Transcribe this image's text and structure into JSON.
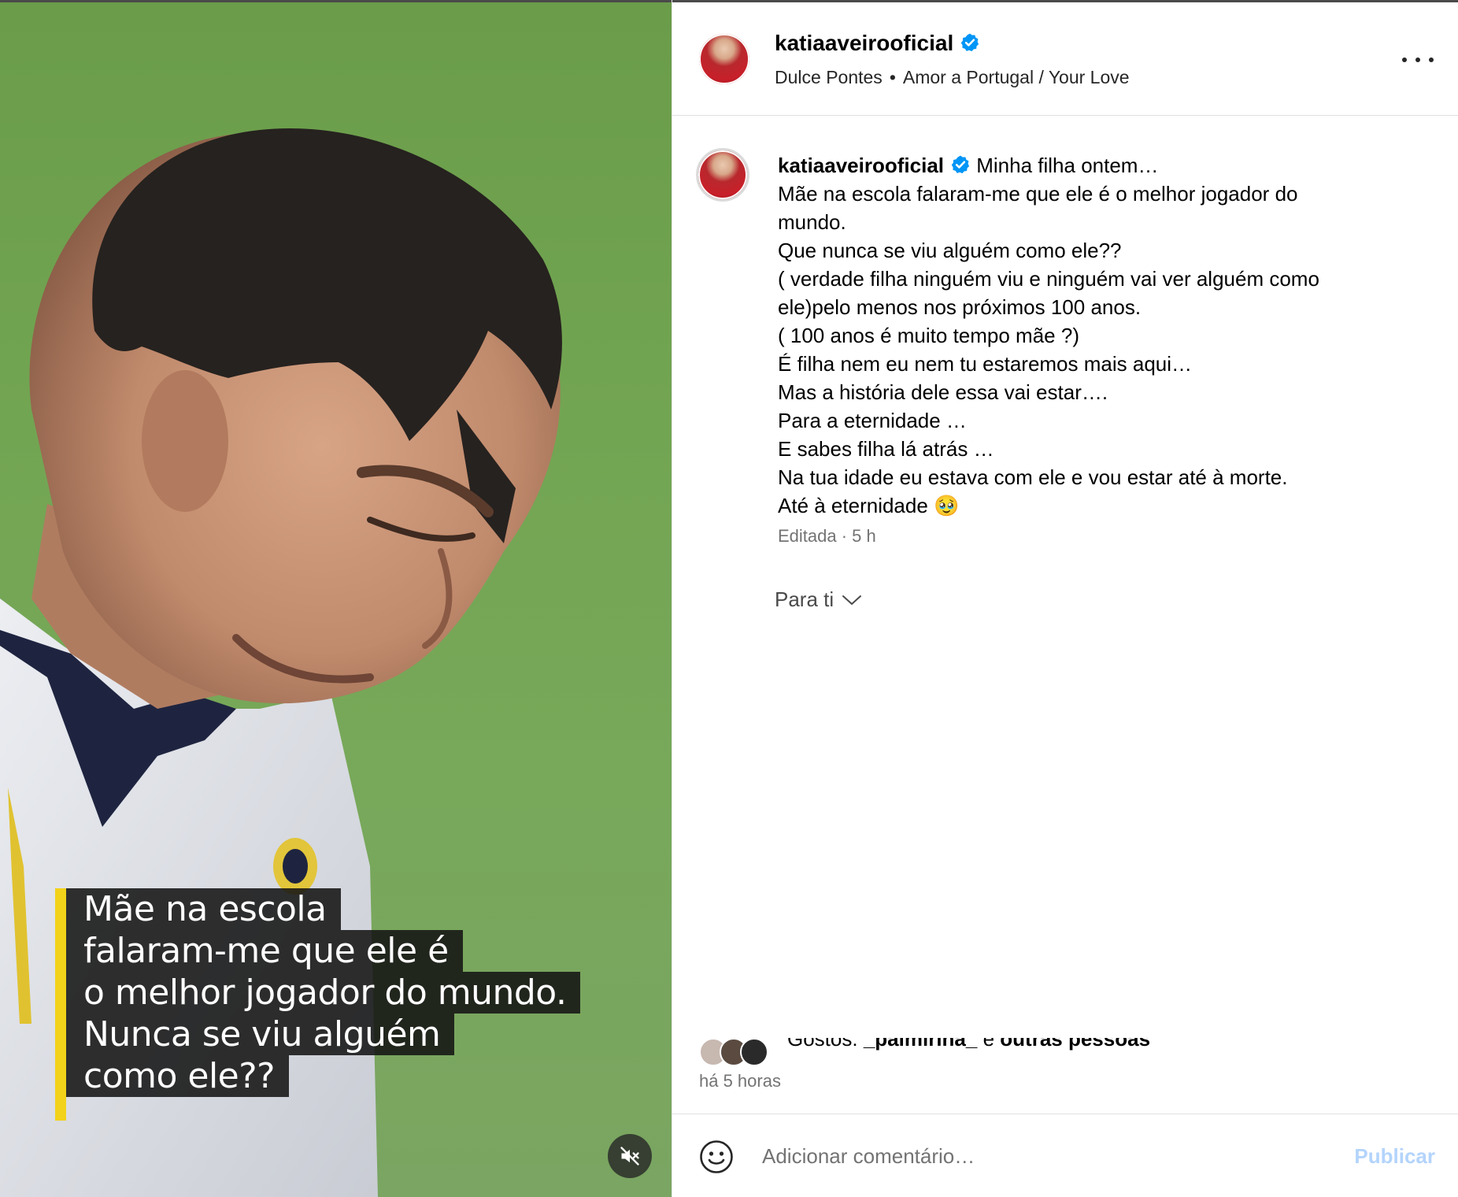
{
  "post": {
    "author": {
      "username": "katiaaveirooficial",
      "verified_icon": "verified-badge-icon"
    },
    "audio": {
      "artist": "Dulce Pontes",
      "separator": "•",
      "track": "Amor a Portugal / Your Love"
    },
    "more_icon": "more-options-icon",
    "caption": {
      "first_line": "Minha filha ontem…",
      "lines": [
        "Mãe na escola falaram-me que ele é o melhor jogador do",
        "mundo.",
        "Que nunca se viu alguém como ele??",
        "( verdade filha ninguém viu e ninguém vai ver alguém como",
        "ele)pelo menos nos próximos 100 anos.",
        "( 100 anos é muito tempo mãe ?)",
        "É filha nem eu nem tu estaremos mais aqui…",
        "Mas a história dele essa vai estar….",
        "Para a eternidade …",
        "E sabes filha lá atrás …",
        "Na tua idade eu estava com ele e vou estar até à morte.",
        "Até à eternidade 🥹"
      ],
      "meta": "Editada · 5 h"
    },
    "translation_menu": {
      "label": "Para ti"
    },
    "likes": {
      "prefix": "Gostos:",
      "user": "_palmirina_",
      "conj": "e",
      "others": "outras pessoas"
    },
    "time_ago": "há 5 horas",
    "comment": {
      "placeholder": "Adicionar comentário…",
      "value": "",
      "publish_label": "Publicar",
      "emoji_icon": "emoji-smile-icon"
    }
  },
  "media": {
    "type": "video",
    "muted": true,
    "mute_icon": "speaker-muted-icon",
    "subtitles": [
      "Mãe na escola",
      "falaram-me que ele é",
      "o melhor jogador do mundo.",
      "Nunca se viu alguém",
      "como ele??"
    ]
  },
  "colors": {
    "link_blue_disabled": "#b3d4fc",
    "verified_blue": "#0095f6",
    "subtitle_bar": "#f2d21a",
    "pitch_green": "#72a552"
  }
}
